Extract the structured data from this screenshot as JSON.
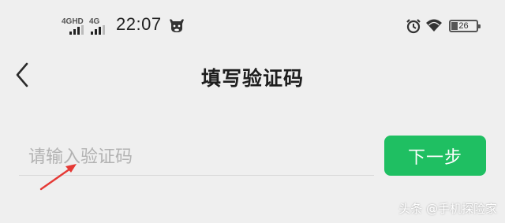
{
  "status_bar": {
    "sim1_network": "4GHD",
    "sim2_network": "4G",
    "time": "22:07",
    "battery_level": "26",
    "icons": [
      "signal-icon",
      "ox-app-icon",
      "alarm-icon",
      "wifi-icon",
      "battery-icon"
    ]
  },
  "nav": {
    "back_icon": "chevron-left-icon",
    "title": "填写验证码"
  },
  "form": {
    "code_placeholder": "请输入验证码",
    "code_value": "",
    "next_label": "下一步"
  },
  "watermark": "头条 @手机探险家",
  "colors": {
    "background": "#efefef",
    "accent_green": "#1fbf62",
    "annotation_arrow": "#e53935"
  }
}
